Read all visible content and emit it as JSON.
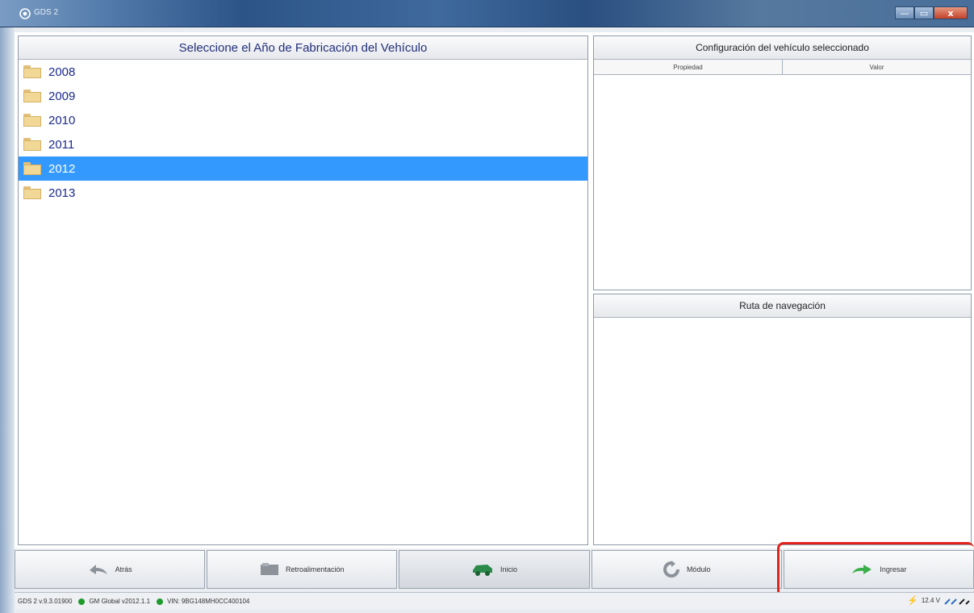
{
  "window": {
    "title": "GDS 2",
    "controls": {
      "minimize": "—",
      "maximize": "▭",
      "close": "x"
    }
  },
  "left_panel": {
    "header": "Seleccione el Año de Fabricación del Vehículo",
    "years": [
      {
        "label": "2008",
        "selected": false
      },
      {
        "label": "2009",
        "selected": false
      },
      {
        "label": "2010",
        "selected": false
      },
      {
        "label": "2011",
        "selected": false
      },
      {
        "label": "2012",
        "selected": true
      },
      {
        "label": "2013",
        "selected": false
      }
    ]
  },
  "config_panel": {
    "header": "Configuración del vehículo seleccionado",
    "columns": [
      "Propiedad",
      "Valor"
    ]
  },
  "nav_panel": {
    "header": "Ruta de navegación"
  },
  "buttons": {
    "back": "Atrás",
    "feedback": "Retroalimentación",
    "home": "Inicio",
    "module": "Módulo",
    "enter": "Ingresar"
  },
  "status": {
    "version": "GDS 2 v.9.3.01900",
    "global": "GM Global v2012.1.1",
    "vin": "VIN: 9BG148MH0CC400104",
    "voltage": "12.4 V",
    "status_color": "#1f9a2c"
  },
  "colors": {
    "selection": "#3399ff",
    "highlight": "#e0241b"
  }
}
